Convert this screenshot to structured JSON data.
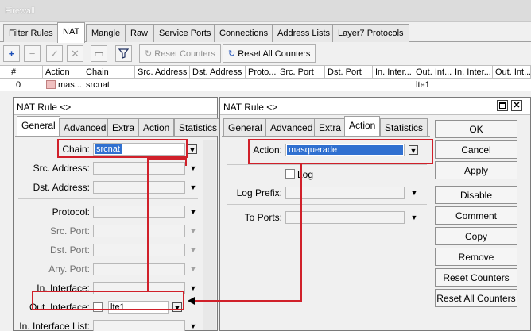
{
  "firewall": {
    "title": "Firewall",
    "tabs": [
      "Filter Rules",
      "NAT",
      "Mangle",
      "Raw",
      "Service Ports",
      "Connections",
      "Address Lists",
      "Layer7 Protocols"
    ],
    "toolbar": {
      "reset_counters": "Reset Counters",
      "reset_all_counters": "Reset All Counters"
    },
    "table": {
      "columns": [
        "#",
        "Action",
        "Chain",
        "Src. Address",
        "Dst. Address",
        "Proto...",
        "Src. Port",
        "Dst. Port",
        "In. Inter...",
        "Out. Int...",
        "In. Inter...",
        "Out. Int..."
      ],
      "row": {
        "num": "0",
        "action": "mas...",
        "chain": "srcnat",
        "out_iface": "lte1"
      }
    }
  },
  "nat_rule_left": {
    "title": "NAT Rule <>",
    "tabs": [
      "General",
      "Advanced",
      "Extra",
      "Action",
      "Statistics"
    ],
    "fields": {
      "chain_label": "Chain:",
      "chain_value": "srcnat",
      "src_address_label": "Src. Address:",
      "dst_address_label": "Dst. Address:",
      "protocol_label": "Protocol:",
      "src_port_label": "Src. Port:",
      "dst_port_label": "Dst. Port:",
      "any_port_label": "Any. Port:",
      "in_interface_label": "In. Interface:",
      "out_interface_label": "Out. Interface:",
      "out_interface_value": "lte1",
      "in_interface_list_label": "In. Interface List:"
    }
  },
  "nat_rule_right": {
    "title": "NAT Rule <>",
    "tabs": [
      "General",
      "Advanced",
      "Extra",
      "Action",
      "Statistics"
    ],
    "fields": {
      "action_label": "Action:",
      "action_value": "masquerade",
      "log_label": "Log",
      "log_prefix_label": "Log Prefix:",
      "to_ports_label": "To Ports:"
    },
    "buttons": [
      "OK",
      "Cancel",
      "Apply",
      "Disable",
      "Comment",
      "Copy",
      "Remove",
      "Reset Counters",
      "Reset All Counters"
    ]
  },
  "colors": {
    "highlight": "#d0202a",
    "selection": "#3070d0"
  }
}
